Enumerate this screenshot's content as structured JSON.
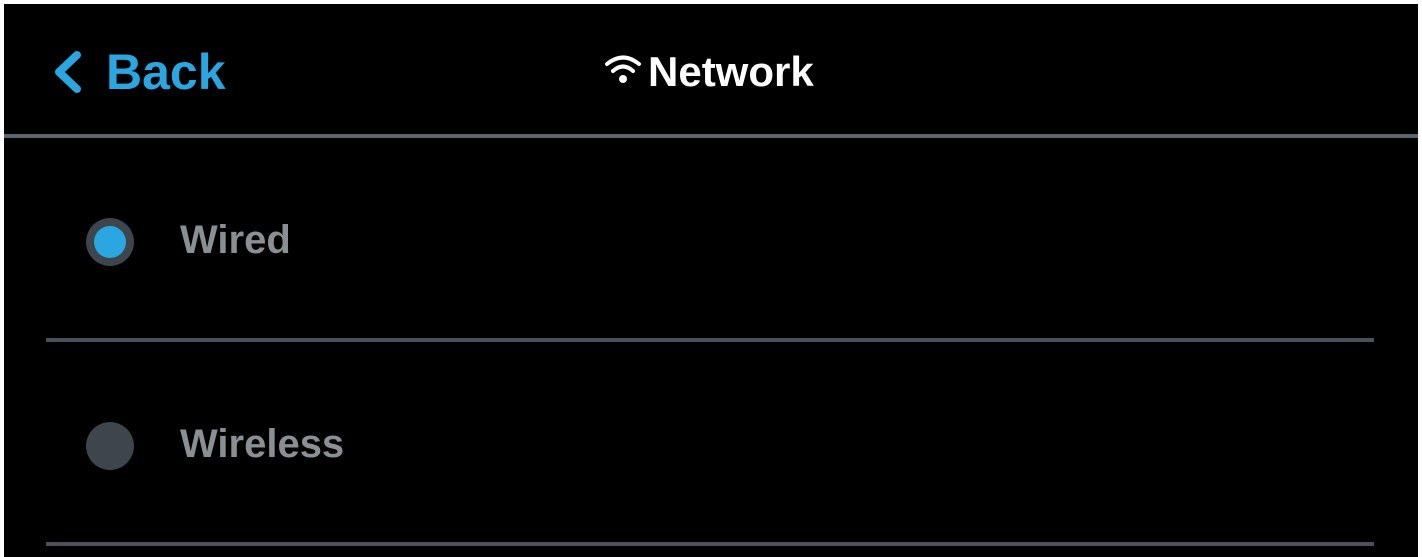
{
  "header": {
    "back_label": "Back",
    "title": "Network",
    "back_icon": "chevron-left-icon",
    "title_icon": "wifi-icon"
  },
  "options": [
    {
      "label": "Wired",
      "selected": true
    },
    {
      "label": "Wireless",
      "selected": false
    }
  ],
  "colors": {
    "accent": "#2aa6e0",
    "background": "#000000",
    "title_text": "#ffffff",
    "option_text": "#8a8f94",
    "radio_off": "#3e454c",
    "divider": "#4a5057"
  }
}
